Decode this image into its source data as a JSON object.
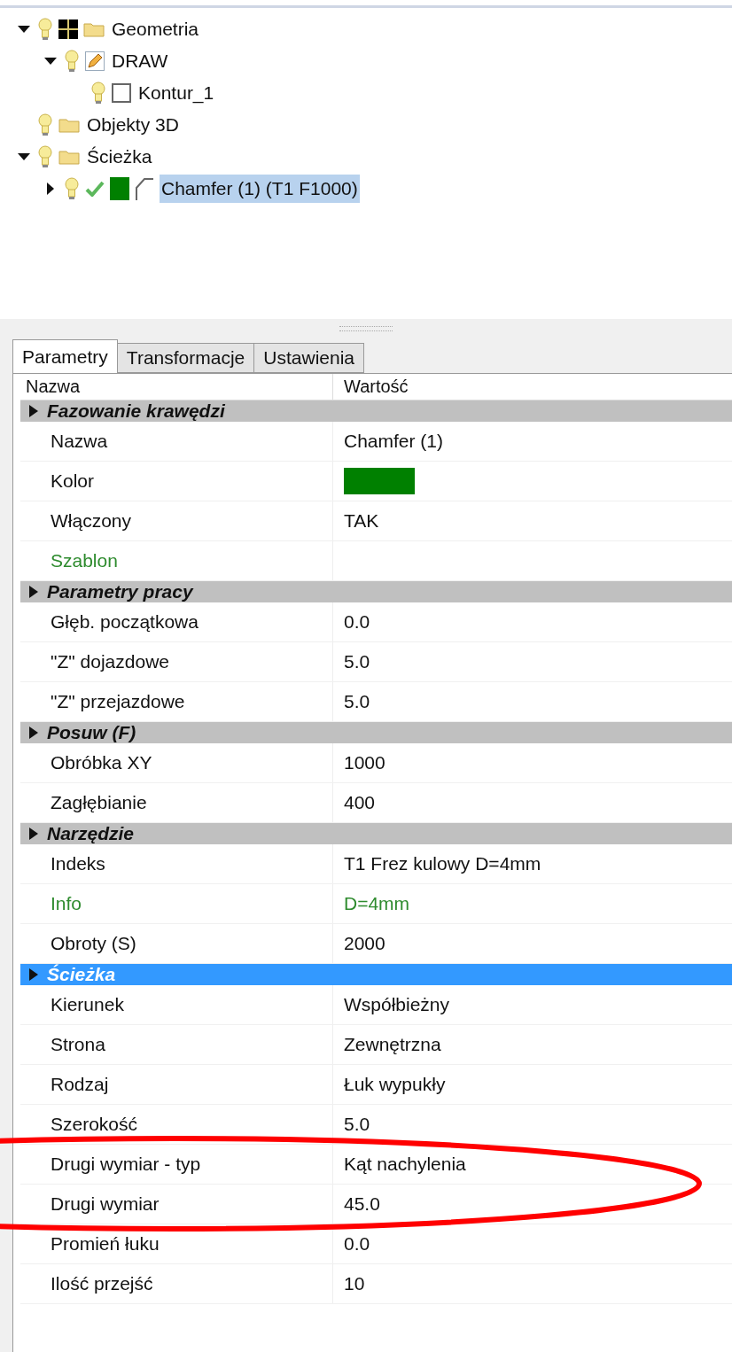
{
  "tree": [
    {
      "label": "Geometria",
      "kind": "geometry",
      "expanded": true,
      "selected": false,
      "children": [
        {
          "label": "DRAW",
          "kind": "drawing",
          "expanded": true,
          "selected": false,
          "children": [
            {
              "label": "Kontur_1",
              "kind": "contour",
              "selected": false
            }
          ]
        }
      ]
    },
    {
      "label": "Objekty 3D",
      "kind": "folder",
      "selected": false
    },
    {
      "label": "Ścieżka",
      "kind": "folder",
      "expanded": true,
      "selected": false,
      "children": [
        {
          "label": "Chamfer (1) (T1 F1000)",
          "kind": "toolpath",
          "expanded": false,
          "selected": true
        }
      ]
    }
  ],
  "tabs": [
    {
      "label": "Parametry",
      "selected": true
    },
    {
      "label": "Transformacje",
      "selected": false
    },
    {
      "label": "Ustawienia",
      "selected": false
    }
  ],
  "columns": [
    "Nazwa",
    "Wartość"
  ],
  "rows": [
    {
      "kind": "group",
      "label": "Fazowanie krawędzi",
      "selected": false
    },
    {
      "kind": "property",
      "name": "Nazwa",
      "value": "Chamfer (1)",
      "linked": false
    },
    {
      "kind": "color",
      "name": "Kolor",
      "color": "#008000",
      "linked": false
    },
    {
      "kind": "property",
      "name": "Włączony",
      "value": "TAK",
      "linked": false
    },
    {
      "kind": "property",
      "name": "Szablon",
      "linked": true
    },
    {
      "kind": "group",
      "label": "Parametry pracy",
      "selected": false
    },
    {
      "kind": "property",
      "name": "Głęb. początkowa",
      "value": "0.0",
      "linked": false
    },
    {
      "kind": "property",
      "name": "\"Z\" dojazdowe",
      "value": "5.0",
      "linked": false
    },
    {
      "kind": "property",
      "name": "\"Z\" przejazdowe",
      "value": "5.0",
      "linked": false
    },
    {
      "kind": "group",
      "label": "Posuw (F)",
      "selected": false
    },
    {
      "kind": "property",
      "name": "Obróbka XY",
      "value": "1000",
      "linked": false
    },
    {
      "kind": "property",
      "name": "Zagłębianie",
      "value": "400",
      "linked": false
    },
    {
      "kind": "group",
      "label": "Narzędzie",
      "selected": false
    },
    {
      "kind": "property",
      "name": "Indeks",
      "value": "T1 Frez kulowy D=4mm",
      "linked": false
    },
    {
      "kind": "property",
      "name": "Info",
      "value": "D=4mm",
      "linked": true
    },
    {
      "kind": "property",
      "name": "Obroty (S)",
      "value": "2000",
      "linked": false
    },
    {
      "kind": "group",
      "label": "Ścieżka",
      "selected": true
    },
    {
      "kind": "property",
      "name": "Kierunek",
      "value": "Współbieżny",
      "linked": false
    },
    {
      "kind": "property",
      "name": "Strona",
      "value": "Zewnętrzna",
      "linked": false
    },
    {
      "kind": "property",
      "name": "Rodzaj",
      "value": "Łuk wypukły",
      "linked": false
    },
    {
      "kind": "property",
      "name": "Szerokość",
      "value": "5.0",
      "linked": false
    },
    {
      "kind": "property",
      "name": "Drugi wymiar - typ",
      "value": "Kąt nachylenia",
      "linked": false
    },
    {
      "kind": "property",
      "name": "Drugi wymiar",
      "value": "45.0",
      "linked": false
    },
    {
      "kind": "property",
      "name": "Promień łuku",
      "value": "0.0",
      "linked": false
    },
    {
      "kind": "property",
      "name": "Ilość przejść",
      "value": "10",
      "linked": false
    }
  ]
}
